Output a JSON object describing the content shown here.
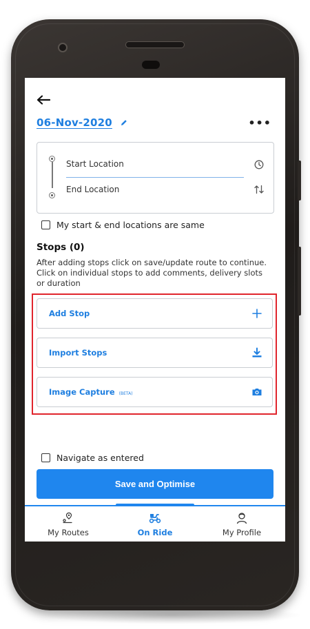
{
  "header": {
    "date_title": "06-Nov-2020",
    "more_label": "•••"
  },
  "locations": {
    "start_placeholder": "Start Location",
    "end_placeholder": "End Location",
    "same_checkbox_label": "My start & end locations are same"
  },
  "stops": {
    "title": "Stops (0)",
    "description": "After adding stops click on save/update route to continue. Click on individual stops to add comments, delivery slots or duration"
  },
  "actions": [
    {
      "label": "Add Stop",
      "icon": "plus-icon"
    },
    {
      "label": "Import Stops",
      "icon": "download-icon"
    },
    {
      "label": "Image Capture",
      "badge": "(BETA)",
      "icon": "camera-icon"
    }
  ],
  "navigate_checkbox_label": "Navigate as entered",
  "save_button_label": "Save and Optimise",
  "tabs": [
    {
      "label": "My Routes",
      "icon": "route-pin-icon",
      "active": false
    },
    {
      "label": "On Ride",
      "icon": "scooter-icon",
      "active": true
    },
    {
      "label": "My Profile",
      "icon": "user-icon",
      "active": false
    }
  ],
  "colors": {
    "accent": "#1f86ee",
    "link": "#1f7fe0",
    "highlight": "#e0242c"
  }
}
